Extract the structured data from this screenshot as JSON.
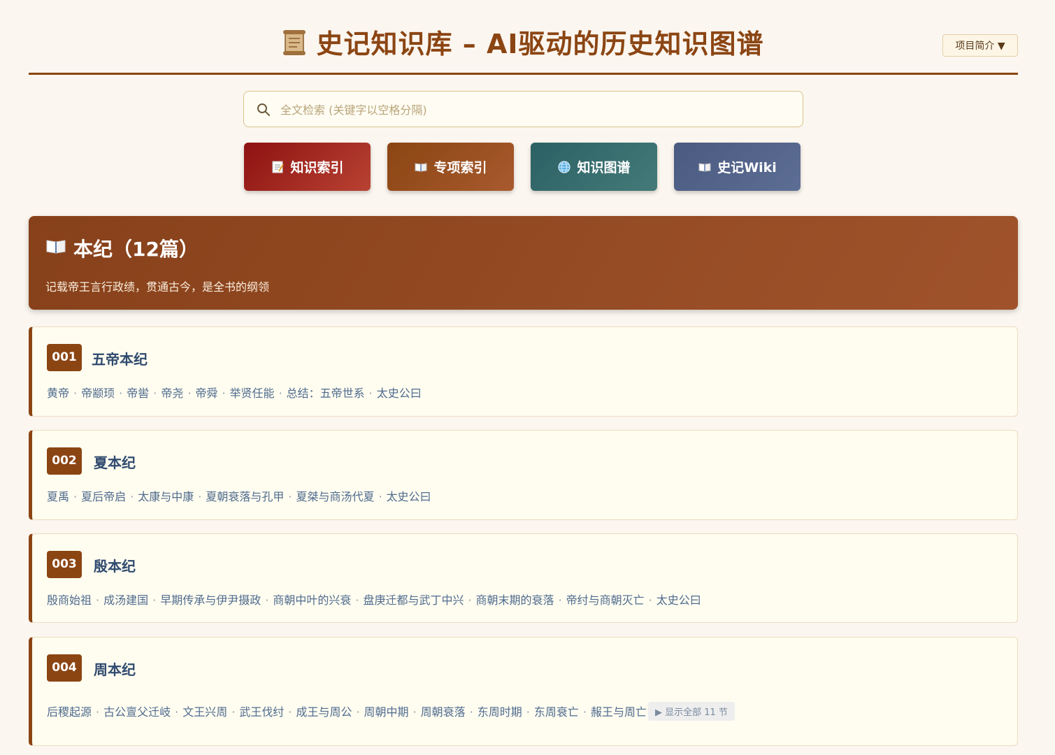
{
  "header": {
    "title": "史记知识库 – AI驱动的历史知识图谱",
    "intro_button": "项目简介 ▼"
  },
  "search": {
    "placeholder": "全文检索 (关键字以空格分隔)"
  },
  "nav": {
    "knowledge_index": "知识索引",
    "special_index": "专项索引",
    "knowledge_graph": "知识图谱",
    "wiki": "史记Wiki"
  },
  "section": {
    "title": "本纪（12篇）",
    "description": "记载帝王言行政绩，贯通古今，是全书的纲领"
  },
  "chapters": [
    {
      "num": "001",
      "title": "五帝本纪",
      "sections": [
        "黄帝",
        "帝颛顼",
        "帝喾",
        "帝尧",
        "帝舜",
        "举贤任能",
        "总结：五帝世系",
        "太史公曰"
      ]
    },
    {
      "num": "002",
      "title": "夏本纪",
      "sections": [
        "夏禹",
        "夏后帝启",
        "太康与中康",
        "夏朝衰落与孔甲",
        "夏桀与商汤代夏",
        "太史公曰"
      ]
    },
    {
      "num": "003",
      "title": "殷本纪",
      "sections": [
        "殷商始祖",
        "成汤建国",
        "早期传承与伊尹摄政",
        "商朝中叶的兴衰",
        "盘庚迁都与武丁中兴",
        "商朝末期的衰落",
        "帝纣与商朝灭亡",
        "太史公曰"
      ]
    },
    {
      "num": "004",
      "title": "周本纪",
      "sections": [
        "后稷起源",
        "古公亶父迁岐",
        "文王兴周",
        "武王伐纣",
        "成王与周公",
        "周朝中期",
        "周朝衰落",
        "东周时期",
        "东周衰亡",
        "赧王与周亡"
      ],
      "show_all": "▶ 显示全部 11 节"
    }
  ],
  "colors": {
    "accent": "#8b4513",
    "background": "#fbf6ef",
    "knowledge_index": "#8e1212",
    "special_index": "#8b4513",
    "knowledge_graph": "#2c6165",
    "wiki": "#4a5a80"
  }
}
